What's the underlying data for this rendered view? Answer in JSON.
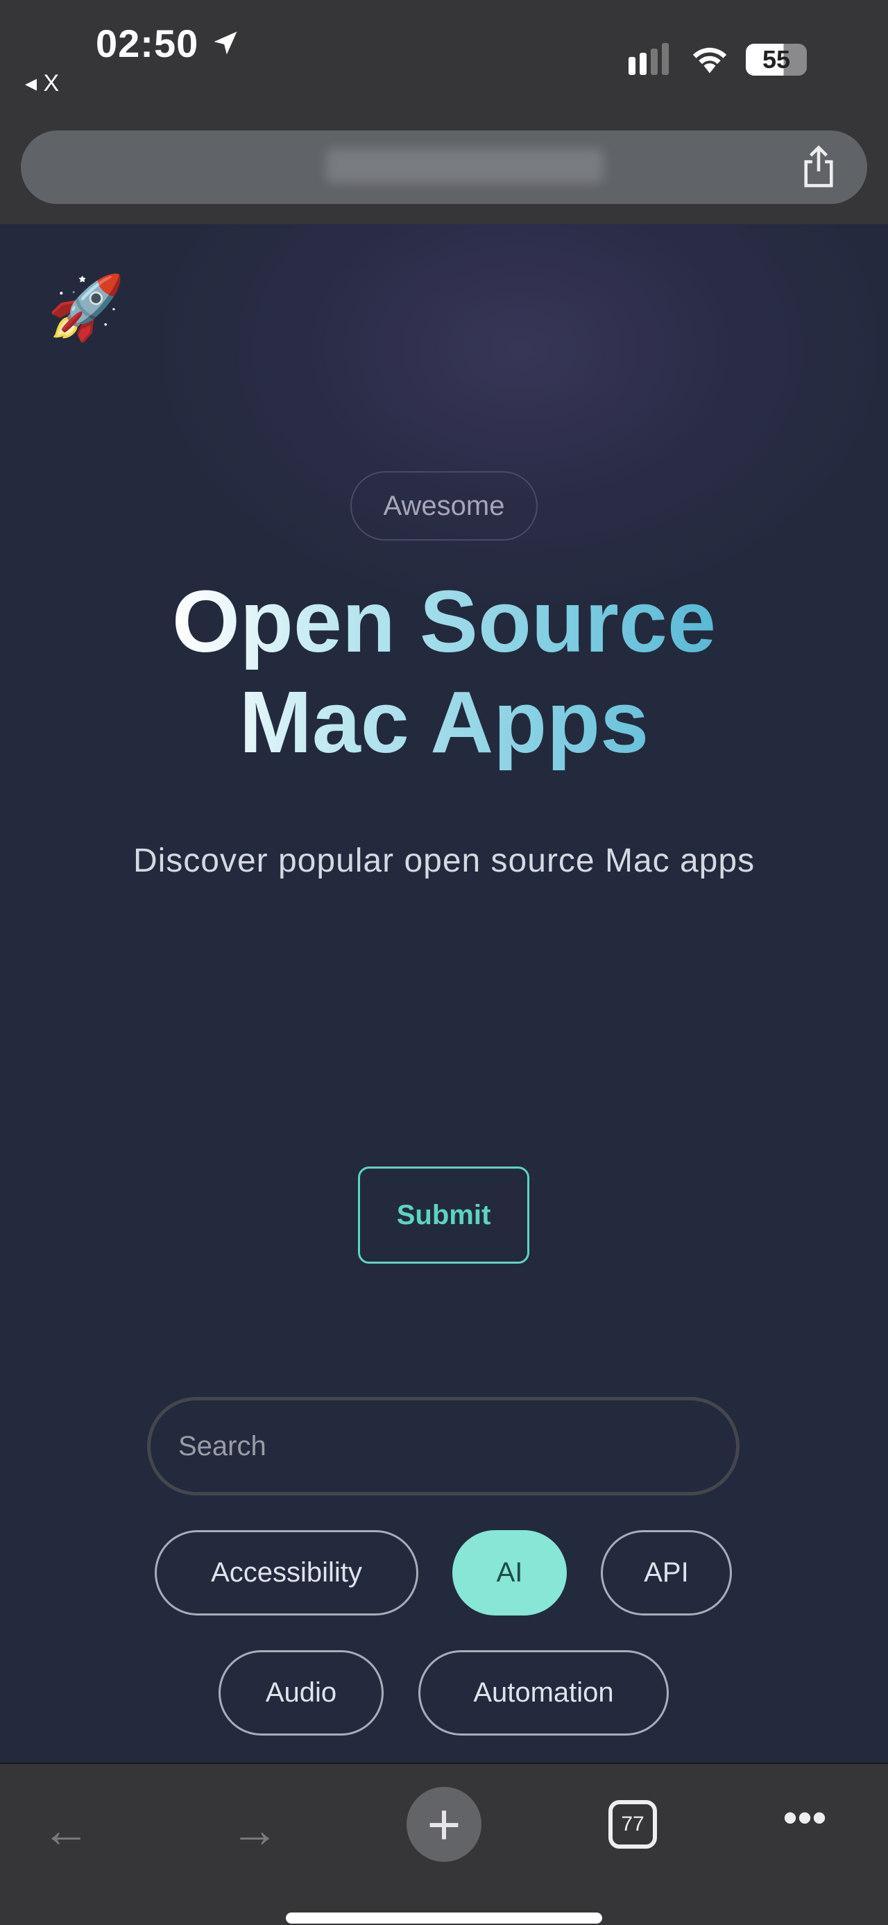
{
  "status_bar": {
    "time": "02:50",
    "back_app": "◂ X",
    "battery": "55",
    "location_icon": "location-arrow-icon",
    "signal_icon": "signal-icon",
    "wifi_icon": "wifi-icon"
  },
  "browser": {
    "share_icon": "share-icon"
  },
  "hero": {
    "logo_icon": "rocket-icon",
    "badge": "Awesome",
    "title_line1": "Open Source",
    "title_line2": "Mac Apps",
    "subtitle": "Discover popular open source Mac apps",
    "submit_label": "Submit"
  },
  "search": {
    "placeholder": "Search",
    "value": ""
  },
  "categories": [
    {
      "label": "Accessibility",
      "active": false
    },
    {
      "label": "AI",
      "active": true
    },
    {
      "label": "API",
      "active": false
    },
    {
      "label": "Audio",
      "active": false
    },
    {
      "label": "Automation",
      "active": false
    }
  ],
  "toolbar": {
    "tab_count": "77",
    "back_icon": "arrow-left-icon",
    "forward_icon": "arrow-right-icon",
    "new_tab_icon": "plus-icon",
    "more_icon": "more-icon"
  },
  "colors": {
    "accent": "#5ed4c0",
    "active_chip": "#87e6d6",
    "background": "#232a3d"
  }
}
